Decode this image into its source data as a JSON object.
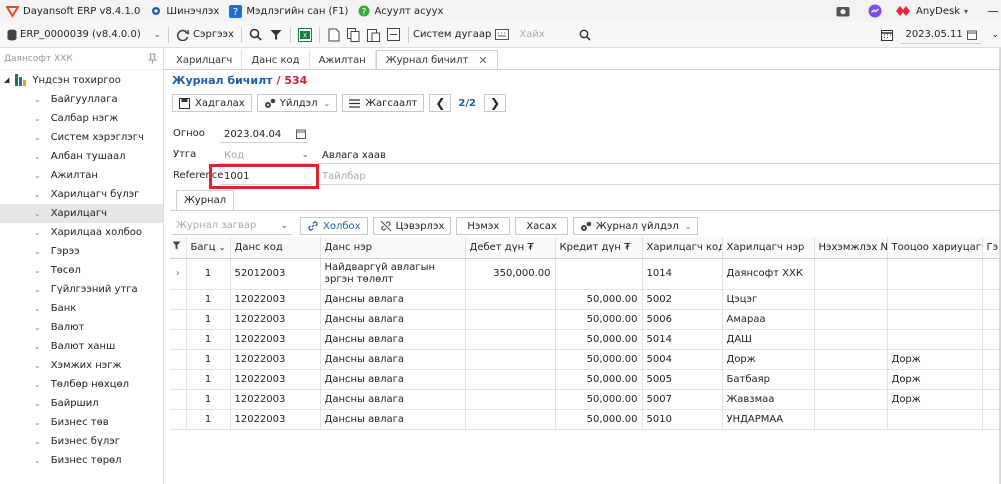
{
  "titlebar": {
    "app_name": "Dayansoft ERP v8.4.1.0",
    "update": "Шинэчлэх",
    "knowledge": "Мэдлэгийн сан (F1)",
    "ask": "Асуулт асуух",
    "anydesk": "AnyDesk"
  },
  "toolbar": {
    "database": "ERP_0000039 (v8.4.0.0)",
    "refresh": "Сэргээх",
    "system_number": "Систем дугаар",
    "search_placeholder": "Хайх",
    "date": "2023.05.11"
  },
  "sidebar": {
    "company": "Даянсофт ХХК",
    "root": "Үндсэн тохиргоо",
    "items": [
      {
        "label": "Байгууллага"
      },
      {
        "label": "Салбар нэгж"
      },
      {
        "label": "Систем хэрэглэгч"
      },
      {
        "label": "Албан тушаал"
      },
      {
        "label": "Ажилтан"
      },
      {
        "label": "Харилцагч бүлэг"
      },
      {
        "label": "Харилцагч",
        "selected": true
      },
      {
        "label": "Харилцаа холбоо"
      },
      {
        "label": "Гэрээ"
      },
      {
        "label": "Төсөл"
      },
      {
        "label": "Гүйлгээний утга"
      },
      {
        "label": "Банк"
      },
      {
        "label": "Валют"
      },
      {
        "label": "Валют ханш"
      },
      {
        "label": "Хэмжих нэгж"
      },
      {
        "label": "Төлбөр нөхцөл"
      },
      {
        "label": "Байршил"
      },
      {
        "label": "Бизнес төв"
      },
      {
        "label": "Бизнес бүлэг"
      },
      {
        "label": "Бизнес төрөл"
      }
    ]
  },
  "tabs": [
    {
      "label": "Харилцагч"
    },
    {
      "label": "Данс код"
    },
    {
      "label": "Ажилтан"
    },
    {
      "label": "Журнал бичилт",
      "active": true
    }
  ],
  "doc": {
    "title": "Журнал бичилт",
    "number": "/ 534"
  },
  "actions": {
    "save": "Хадгалах",
    "operation": "Үйлдэл",
    "sort": "Жагсаалт",
    "pager": "2/2"
  },
  "form": {
    "date_label": "Огноо",
    "date_value": "2023.04.04",
    "meaning_label": "Утга",
    "code_placeholder": "Код",
    "meaning_value": "Авлага хаав",
    "reference_label": "Reference",
    "reference_value": "1001",
    "description_placeholder": "Тайлбар"
  },
  "journal": {
    "tab": "Журнал",
    "template_placeholder": "Журнал загвар",
    "link": "Холбох",
    "unlink": "Цэвэрлэх",
    "add": "Нэмэх",
    "remove": "Хасах",
    "journal_action": "Журнал үйлдэл",
    "columns": [
      "Багц",
      "Данс код",
      "Данс нэр",
      "Дебет дүн ₮",
      "Кредит дүн ₮",
      "Харилцагч код",
      "Харилцагч нэр",
      "Нэхэмжлэх №",
      "Тооцоо хариуцагч",
      "Гэ"
    ],
    "rows": [
      {
        "batch": "1",
        "account": "52012003",
        "name": "Найдваргүй авлагын эргэн төлөлт",
        "debit": "350,000.00",
        "credit": "",
        "partner_code": "1014",
        "partner_name": "Даянсофт ХХК",
        "invoice": "",
        "owner": ""
      },
      {
        "batch": "1",
        "account": "12022003",
        "name": "Дансны авлага",
        "debit": "",
        "credit": "50,000.00",
        "partner_code": "5002",
        "partner_name": "Цэцэг",
        "invoice": "",
        "owner": ""
      },
      {
        "batch": "1",
        "account": "12022003",
        "name": "Дансны авлага",
        "debit": "",
        "credit": "50,000.00",
        "partner_code": "5006",
        "partner_name": "Амараа",
        "invoice": "",
        "owner": ""
      },
      {
        "batch": "1",
        "account": "12022003",
        "name": "Дансны авлага",
        "debit": "",
        "credit": "50,000.00",
        "partner_code": "5014",
        "partner_name": "ДАШ",
        "invoice": "",
        "owner": ""
      },
      {
        "batch": "1",
        "account": "12022003",
        "name": "Дансны авлага",
        "debit": "",
        "credit": "50,000.00",
        "partner_code": "5004",
        "partner_name": "Дорж",
        "invoice": "",
        "owner": "Дорж"
      },
      {
        "batch": "1",
        "account": "12022003",
        "name": "Дансны авлага",
        "debit": "",
        "credit": "50,000.00",
        "partner_code": "5005",
        "partner_name": "Батбаяр",
        "invoice": "",
        "owner": "Дорж"
      },
      {
        "batch": "1",
        "account": "12022003",
        "name": "Дансны авлага",
        "debit": "",
        "credit": "50,000.00",
        "partner_code": "5007",
        "partner_name": "Жавзмаа",
        "invoice": "",
        "owner": "Дорж"
      },
      {
        "batch": "1",
        "account": "12022003",
        "name": "Дансны авлага",
        "debit": "",
        "credit": "50,000.00",
        "partner_code": "5010",
        "partner_name": "УНДАРМАА",
        "invoice": "",
        "owner": ""
      }
    ]
  },
  "colors": {
    "accent": "#1e5fa8",
    "highlight": "#e0242b",
    "doc_number": "#d0233a"
  }
}
